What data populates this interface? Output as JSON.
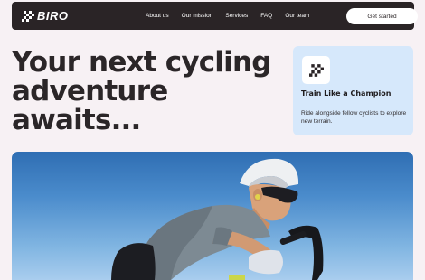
{
  "nav": {
    "brand": "BIRO",
    "links": [
      "About us",
      "Our mission",
      "Services",
      "FAQ",
      "Our team"
    ],
    "cta_label": "Get started"
  },
  "hero": {
    "headline_lines": [
      "Your next cycling",
      "adventure",
      "awaits..."
    ]
  },
  "card": {
    "title": "Train Like a Champion",
    "description": "Ride alongside fellow cyclists to explore new terrain."
  },
  "colors": {
    "page_bg": "#f7f1f4",
    "nav_bg": "#2a2426",
    "card_bg": "#d6e8fb",
    "sky": "#4b8ccc"
  },
  "icons": {
    "brand": "checkered-flag-icon",
    "card": "checkered-flag-icon"
  }
}
